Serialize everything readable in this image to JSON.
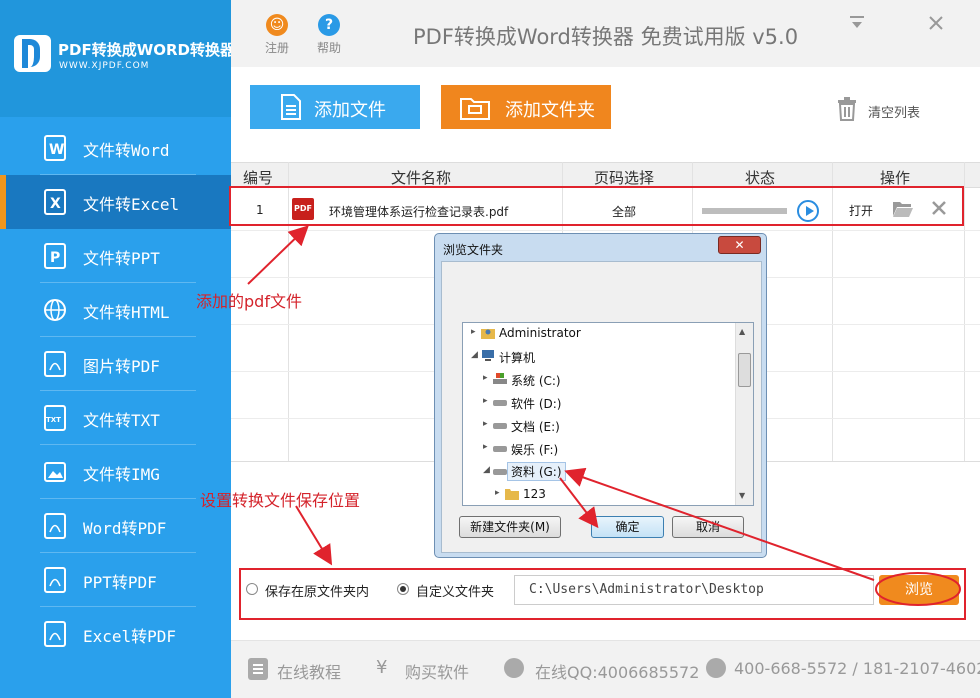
{
  "app": {
    "logo_title": "PDF转换成WORD转换器",
    "logo_url": "WWW.XJPDF.COM",
    "window_title": "PDF转换成Word转换器 免费试用版 v5.0",
    "register_label": "注册",
    "help_label": "帮助"
  },
  "sidebar": {
    "items": [
      {
        "label": "文件转Word",
        "icon": "word-icon"
      },
      {
        "label": "文件转Excel",
        "icon": "excel-icon"
      },
      {
        "label": "文件转PPT",
        "icon": "ppt-icon"
      },
      {
        "label": "文件转HTML",
        "icon": "globe-icon"
      },
      {
        "label": "图片转PDF",
        "icon": "pdf-icon"
      },
      {
        "label": "文件转TXT",
        "icon": "txt-icon"
      },
      {
        "label": "文件转IMG",
        "icon": "image-icon"
      },
      {
        "label": "Word转PDF",
        "icon": "pdf-icon"
      },
      {
        "label": "PPT转PDF",
        "icon": "pdf-icon"
      },
      {
        "label": "Excel转PDF",
        "icon": "pdf-icon"
      }
    ]
  },
  "toolbar": {
    "add_file_label": "添加文件",
    "add_folder_label": "添加文件夹",
    "clear_list_label": "清空列表"
  },
  "table": {
    "headers": [
      "编号",
      "文件名称",
      "页码选择",
      "状态",
      "操作"
    ],
    "rows": [
      {
        "index": "1",
        "file_name": "环境管理体系运行检查记录表.pdf",
        "pages": "全部",
        "progress": 0,
        "action": "打开"
      }
    ]
  },
  "save": {
    "option_original": "保存在原文件夹内",
    "option_custom": "自定义文件夹",
    "selected": "custom",
    "path": "C:\\Users\\Administrator\\Desktop",
    "browse_label": "浏览"
  },
  "footer": {
    "tutorial": "在线教程",
    "buy": "购买软件",
    "qq": "在线QQ:4006685572",
    "phone": "400-668-5572 / 181-2107-4602"
  },
  "dialog": {
    "title": "浏览文件夹",
    "close_label": "✕",
    "tree": [
      {
        "label": "Administrator",
        "expander": "▸"
      },
      {
        "label": "计算机",
        "expander": "◢"
      },
      {
        "label": "系统 (C:)",
        "expander": "▸"
      },
      {
        "label": "软件 (D:)",
        "expander": "▸"
      },
      {
        "label": "文档 (E:)",
        "expander": "▸"
      },
      {
        "label": "娱乐 (F:)",
        "expander": "▸"
      },
      {
        "label": "资料 (G:)",
        "expander": "◢",
        "selected": true
      },
      {
        "label": "123",
        "expander": "▸"
      }
    ],
    "new_folder_label": "新建文件夹(M)",
    "ok_label": "确定",
    "cancel_label": "取消"
  },
  "annotations": {
    "added_pdf": "添加的pdf文件",
    "set_save_location": "设置转换文件保存位置"
  },
  "colors": {
    "sidebar_bg": "#2aa0ec",
    "active_item_bg": "#1978c0",
    "accent_orange": "#f0861e",
    "add_button_blue": "#3aa9ee",
    "annotation_red": "#e0232d"
  }
}
